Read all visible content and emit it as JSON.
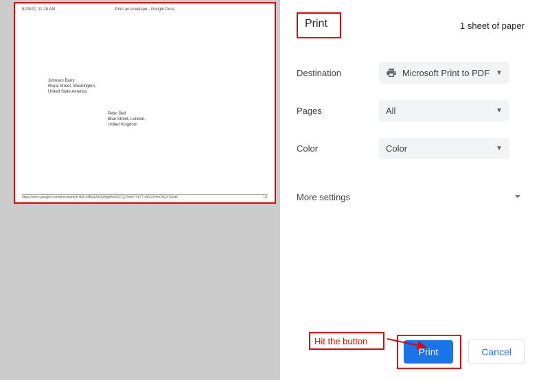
{
  "preview": {
    "header_left": "8/29/22, 11:18 AM",
    "header_center": "Print an envelope - Google Docs",
    "from_line1": "Johnson Barry",
    "from_line2": "Royal Street, Washington,",
    "from_line3": "United State America",
    "to_line1": "Peter Bell",
    "to_line2": "Blue Street, London,",
    "to_line3": "United Kingdom",
    "footer_left": "https://docs.google.com/document/d/1MCz3Bn4Za3Q8qj9BbM1CQZ1mNTYpTT-mN12HhK0KyYU/edit",
    "footer_right": "1/1"
  },
  "dialog": {
    "title": "Print",
    "sheet_info": "1 sheet of paper",
    "destination_label": "Destination",
    "destination_value": "Microsoft Print to PDF",
    "pages_label": "Pages",
    "pages_value": "All",
    "color_label": "Color",
    "color_value": "Color",
    "more_settings": "More settings",
    "print_button": "Print",
    "cancel_button": "Cancel"
  },
  "annotation": {
    "hit_label": "Hit the button"
  }
}
